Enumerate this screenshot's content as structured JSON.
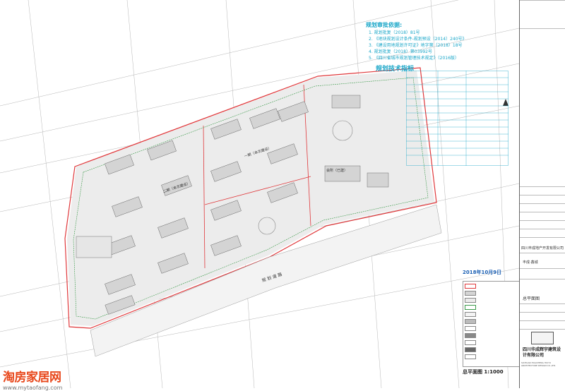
{
  "basis": {
    "heading": "规划审批依据:",
    "items": [
      "1. 规划批复（2018）81号",
      "2. 《地块规划设计条件-规划预设（2014）240号》",
      "3. 《建设用地规划许可证》地字第（2018）18号",
      "4. 规划批复（2018）第03992号",
      "5. 《四川省城市规划管理技术规定》（2016版）"
    ]
  },
  "indicators": {
    "heading": "规划技术指标"
  },
  "plan_labels": {
    "phase1": "一期（本次建设）",
    "phase2": "二期（本次建设）",
    "club": "会所（已建）",
    "road": "规 划 道 路"
  },
  "date_stamp": "2018年10月9日",
  "scale_label": "总平面图 1:1000",
  "title_block": {
    "client": "四川丰成地产开发有限公司",
    "project": "丰成·鑫城",
    "drawing": "总平面图",
    "company_cn": "四川华成辉宇建筑设计有限公司",
    "company_en": "SICHUAN HUACHENG HUIYU ARCHITECTURE DESIGN CO.,LTD."
  },
  "watermark": {
    "logo": "淘房家居网",
    "url": "www.mytaofang.com"
  },
  "colors": {
    "redline": "#e0383b",
    "grid": "#9a9a9a",
    "green": "#3b9a4a",
    "cyan": "#19a6c8"
  }
}
